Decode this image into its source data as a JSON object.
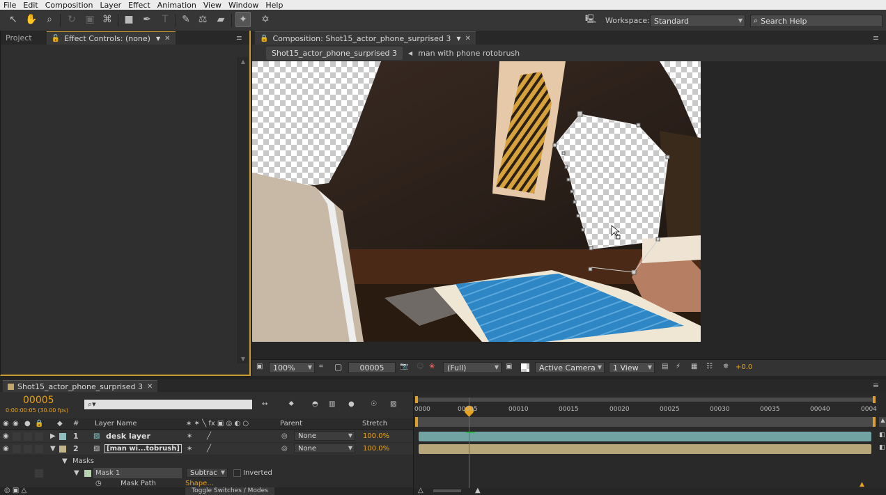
{
  "menu": [
    "File",
    "Edit",
    "Composition",
    "Layer",
    "Effect",
    "Animation",
    "View",
    "Window",
    "Help"
  ],
  "toolbar": {
    "workspace_label": "Workspace:",
    "workspace_value": "Standard",
    "search_placeholder": "Search Help"
  },
  "left_panel": {
    "tabs": [
      "Project",
      "Effect Controls: (none)"
    ]
  },
  "comp_panel": {
    "tab": "Composition: Shot15_actor_phone_surprised 3",
    "breadcrumb": [
      "Shot15_actor_phone_surprised 3",
      "man with phone rotobrush"
    ],
    "zoom": "100%",
    "frame": "00005",
    "resolution": "(Full)",
    "camera": "Active Camera",
    "views": "1 View",
    "exposure": "+0.0"
  },
  "timeline": {
    "tab": "Shot15_actor_phone_surprised 3",
    "timecode": "00005",
    "timecode_sub": "0:00:00:05 (30.00 fps)",
    "search_placeholder": "⌕▾",
    "columns": {
      "num": "#",
      "layer_name": "Layer Name",
      "parent": "Parent",
      "stretch": "Stretch"
    },
    "ruler": [
      "0000",
      "00005",
      "00010",
      "00015",
      "00020",
      "00025",
      "00030",
      "00035",
      "00040",
      "0004"
    ],
    "layers": [
      {
        "num": "1",
        "name": "desk layer",
        "parent": "None",
        "stretch": "100.0%",
        "color": "#8fbfbf"
      },
      {
        "num": "2",
        "name": "[man wi...tobrush]",
        "parent": "None",
        "stretch": "100.0%",
        "color": "#c4b48a"
      }
    ],
    "masks_label": "Masks",
    "mask": {
      "name": "Mask 1",
      "mode": "Subtrac",
      "inverted": "Inverted"
    },
    "mask_path_label": "Mask Path",
    "mask_path_value": "Shape...",
    "toggle_label": "Toggle Switches / Modes"
  },
  "colors": {
    "accent": "#e8a21c",
    "playhead": "#e23b2a",
    "layer1_bar": "#71a3a3",
    "layer2_bar": "#b7a679"
  }
}
